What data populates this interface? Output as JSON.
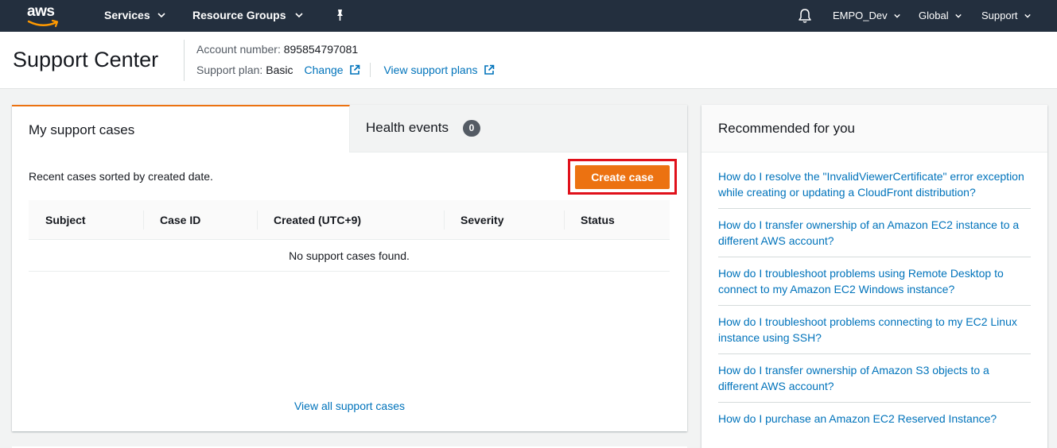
{
  "nav": {
    "logo": "aws",
    "services": "Services",
    "resource_groups": "Resource Groups",
    "account": "EMPO_Dev",
    "region": "Global",
    "support": "Support"
  },
  "header": {
    "title": "Support Center",
    "account_label": "Account number:",
    "account_number": "895854797081",
    "plan_label": "Support plan:",
    "plan_value": "Basic",
    "change_link": "Change",
    "view_plans_link": "View support plans"
  },
  "cases": {
    "tabs": [
      {
        "label": "My support cases"
      },
      {
        "label": "Health events",
        "count": "0"
      }
    ],
    "description": "Recent cases sorted by created date.",
    "create_button": "Create case",
    "columns": [
      "Subject",
      "Case ID",
      "Created (UTC+9)",
      "Severity",
      "Status"
    ],
    "empty_text": "No support cases found.",
    "view_all": "View all support cases"
  },
  "recommended": {
    "title": "Recommended for you",
    "items": [
      "How do I resolve the \"InvalidViewerCertificate\" error exception while creating or updating a CloudFront distribution?",
      "How do I transfer ownership of an Amazon EC2 instance to a different AWS account?",
      "How do I troubleshoot problems using Remote Desktop to connect to my Amazon EC2 Windows instance?",
      "How do I troubleshoot problems connecting to my EC2 Linux instance using SSH?",
      "How do I transfer ownership of Amazon S3 objects to a different AWS account?",
      "How do I purchase an Amazon EC2 Reserved Instance?"
    ]
  },
  "colors": {
    "nav_bg": "#232f3e",
    "accent_orange": "#ec7211",
    "link_blue": "#0073bb",
    "highlight_red": "#e0111b"
  }
}
